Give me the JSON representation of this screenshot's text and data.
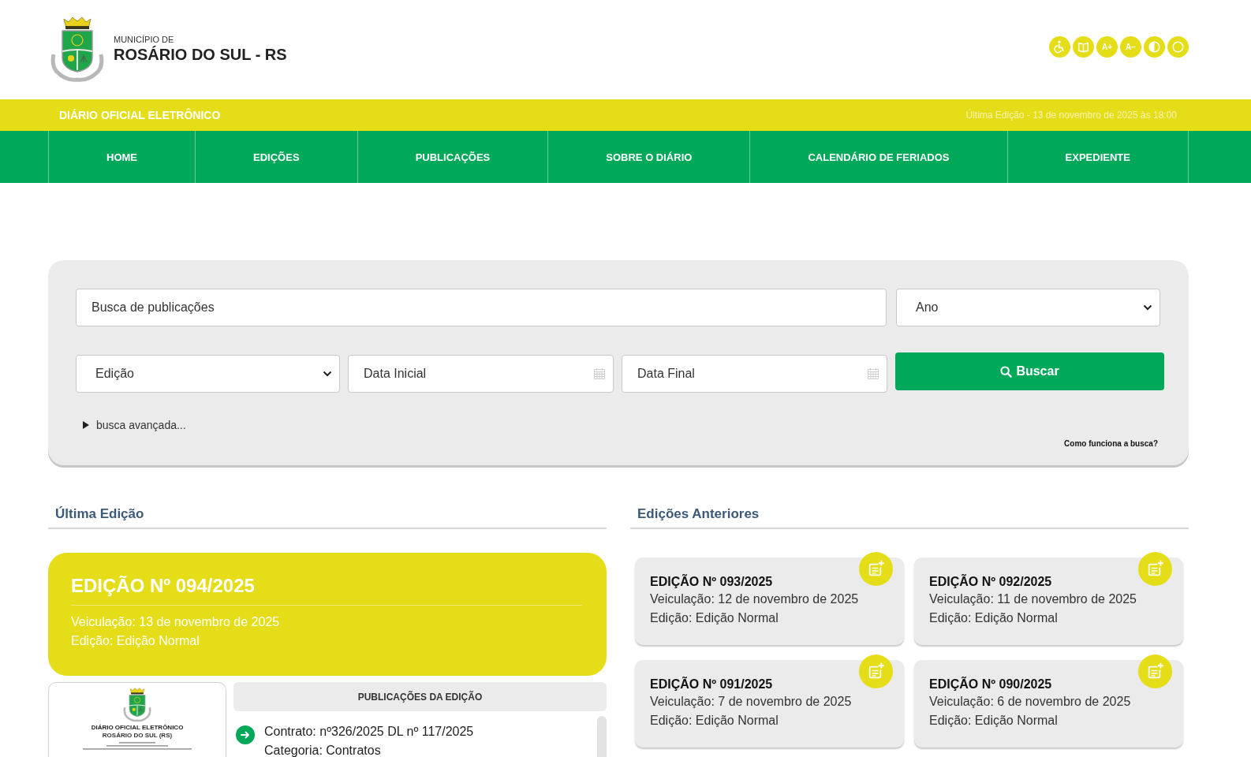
{
  "header": {
    "municipality_label": "MUNICÍPIO DE",
    "municipality_name": "ROSÁRIO DO SUL - RS",
    "accessibility_buttons": [
      {
        "kind": "wheelchair"
      },
      {
        "kind": "book"
      },
      {
        "kind": "text",
        "label": "A+"
      },
      {
        "kind": "text",
        "label": "A–"
      },
      {
        "kind": "contrast"
      },
      {
        "kind": "circle"
      }
    ]
  },
  "banner": {
    "title": "DIÁRIO OFICIAL ELETRÔNICO",
    "last_edition": "Última Edição - 13 de novembro de 2025 às 18:00"
  },
  "nav": {
    "items": [
      {
        "label": "HOME"
      },
      {
        "label": "EDIÇÕES"
      },
      {
        "label": "PUBLICAÇÕES"
      },
      {
        "label": "SOBRE O DIÁRIO"
      },
      {
        "label": "CALENDÁRIO DE FERIADOS"
      },
      {
        "label": "EXPEDIENTE"
      }
    ]
  },
  "search": {
    "query_placeholder": "Busca de publicações",
    "year_select": "Ano",
    "edition_select": "Edição",
    "start_date_placeholder": "Data Inicial",
    "end_date_placeholder": "Data Final",
    "button": "Buscar",
    "advanced": {
      "label": "busca avançada...",
      "expanded": false
    },
    "help_link": "Como funciona a busca?"
  },
  "latest_edition": {
    "heading": "Última Edição",
    "title": "EDIÇÃO Nº 094/2025",
    "date": "Veiculação: 13 de novembro de 2025",
    "type": "Edição: Edição Normal",
    "preview": {
      "title": "DIÁRIO OFICIAL ELETRÔNICO",
      "subtitle": "ROSÁRIO DO SUL (RS)"
    },
    "publications": {
      "heading": "PUBLICAÇÕES DA EDIÇÃO",
      "items": [
        {
          "title": "Contrato: nº326/2025 DL nº 117/2025",
          "category": "Categoria: Contratos"
        }
      ]
    }
  },
  "previous_editions": {
    "heading": "Edições Anteriores",
    "items": [
      {
        "title": "EDIÇÃO Nº 093/2025",
        "date": "Veiculação: 12 de novembro de 2025",
        "type": "Edição: Edição Normal"
      },
      {
        "title": "EDIÇÃO Nº 092/2025",
        "date": "Veiculação: 11 de novembro de 2025",
        "type": "Edição: Edição Normal"
      },
      {
        "title": "EDIÇÃO Nº 091/2025",
        "date": "Veiculação: 7 de novembro de 2025",
        "type": "Edição: Edição Normal"
      },
      {
        "title": "EDIÇÃO Nº 090/2025",
        "date": "Veiculação: 6 de novembro de 2025",
        "type": "Edição: Edição Normal"
      }
    ]
  }
}
